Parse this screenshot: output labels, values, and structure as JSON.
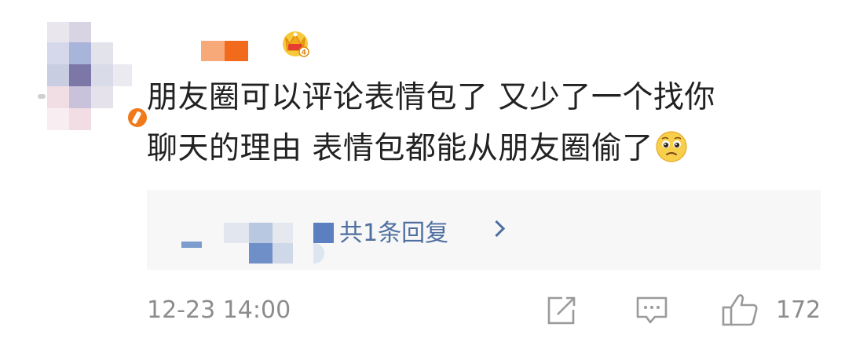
{
  "comment": {
    "line1": "朋友圈可以评论表情包了 又少了一个找你",
    "line2": "聊天的理由 表情包都能从朋友圈偷了"
  },
  "reply": {
    "label": "共1条回复"
  },
  "footer": {
    "timestamp": "12-23 14:00",
    "like_count": "172"
  },
  "icons": {
    "repost": "share-square-icon",
    "comment": "comment-bubble-icon",
    "like": "thumbs-up-icon",
    "crown": "crown-level-badge-icon",
    "emoji": "pleading-face-emoji"
  },
  "colors": {
    "text": "#222222",
    "muted": "#8c8c8c",
    "link": "#4e6fa0",
    "reply_bg": "#f7f7f7",
    "accent_orange": "#f07a1a"
  }
}
